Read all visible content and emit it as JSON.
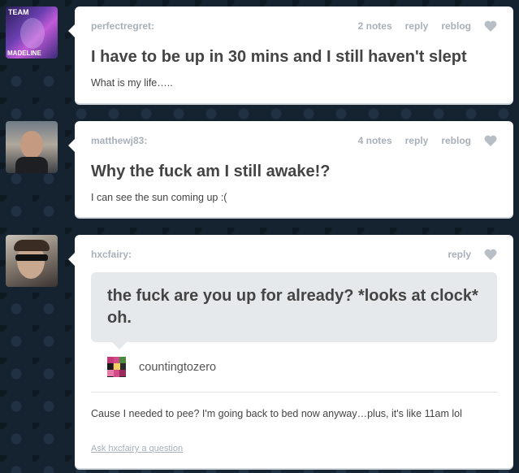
{
  "posts": [
    {
      "avatar_text_top": "TEAM",
      "avatar_text_bottom": "MADELINE",
      "username": "perfectregret:",
      "notes": "2 notes",
      "reply_label": "reply",
      "reblog_label": "reblog",
      "title": "I have to be up in 30 mins and I still haven't slept",
      "body": "What is my life….."
    },
    {
      "username": "matthewj83:",
      "notes": "4 notes",
      "reply_label": "reply",
      "reblog_label": "reblog",
      "title": "Why the fuck am I still awake!?",
      "body": "I can see the sun coming up :("
    },
    {
      "username": "hxcfairy:",
      "reply_label": "reply",
      "question": "the fuck are you up for already? *looks at clock* oh.",
      "asker": "countingtozero",
      "answer": "Cause I needed to pee? I'm going back to bed now anyway…plus, it's like 11am lol",
      "ask_link": "Ask hxcfairy a question"
    }
  ],
  "colors": {
    "background": "#152230",
    "card": "#ffffff",
    "meta_text": "#a8b0b8",
    "body_text": "#444444",
    "question_bg": "#e6e9ec"
  },
  "icons": {
    "like": "heart-icon"
  }
}
